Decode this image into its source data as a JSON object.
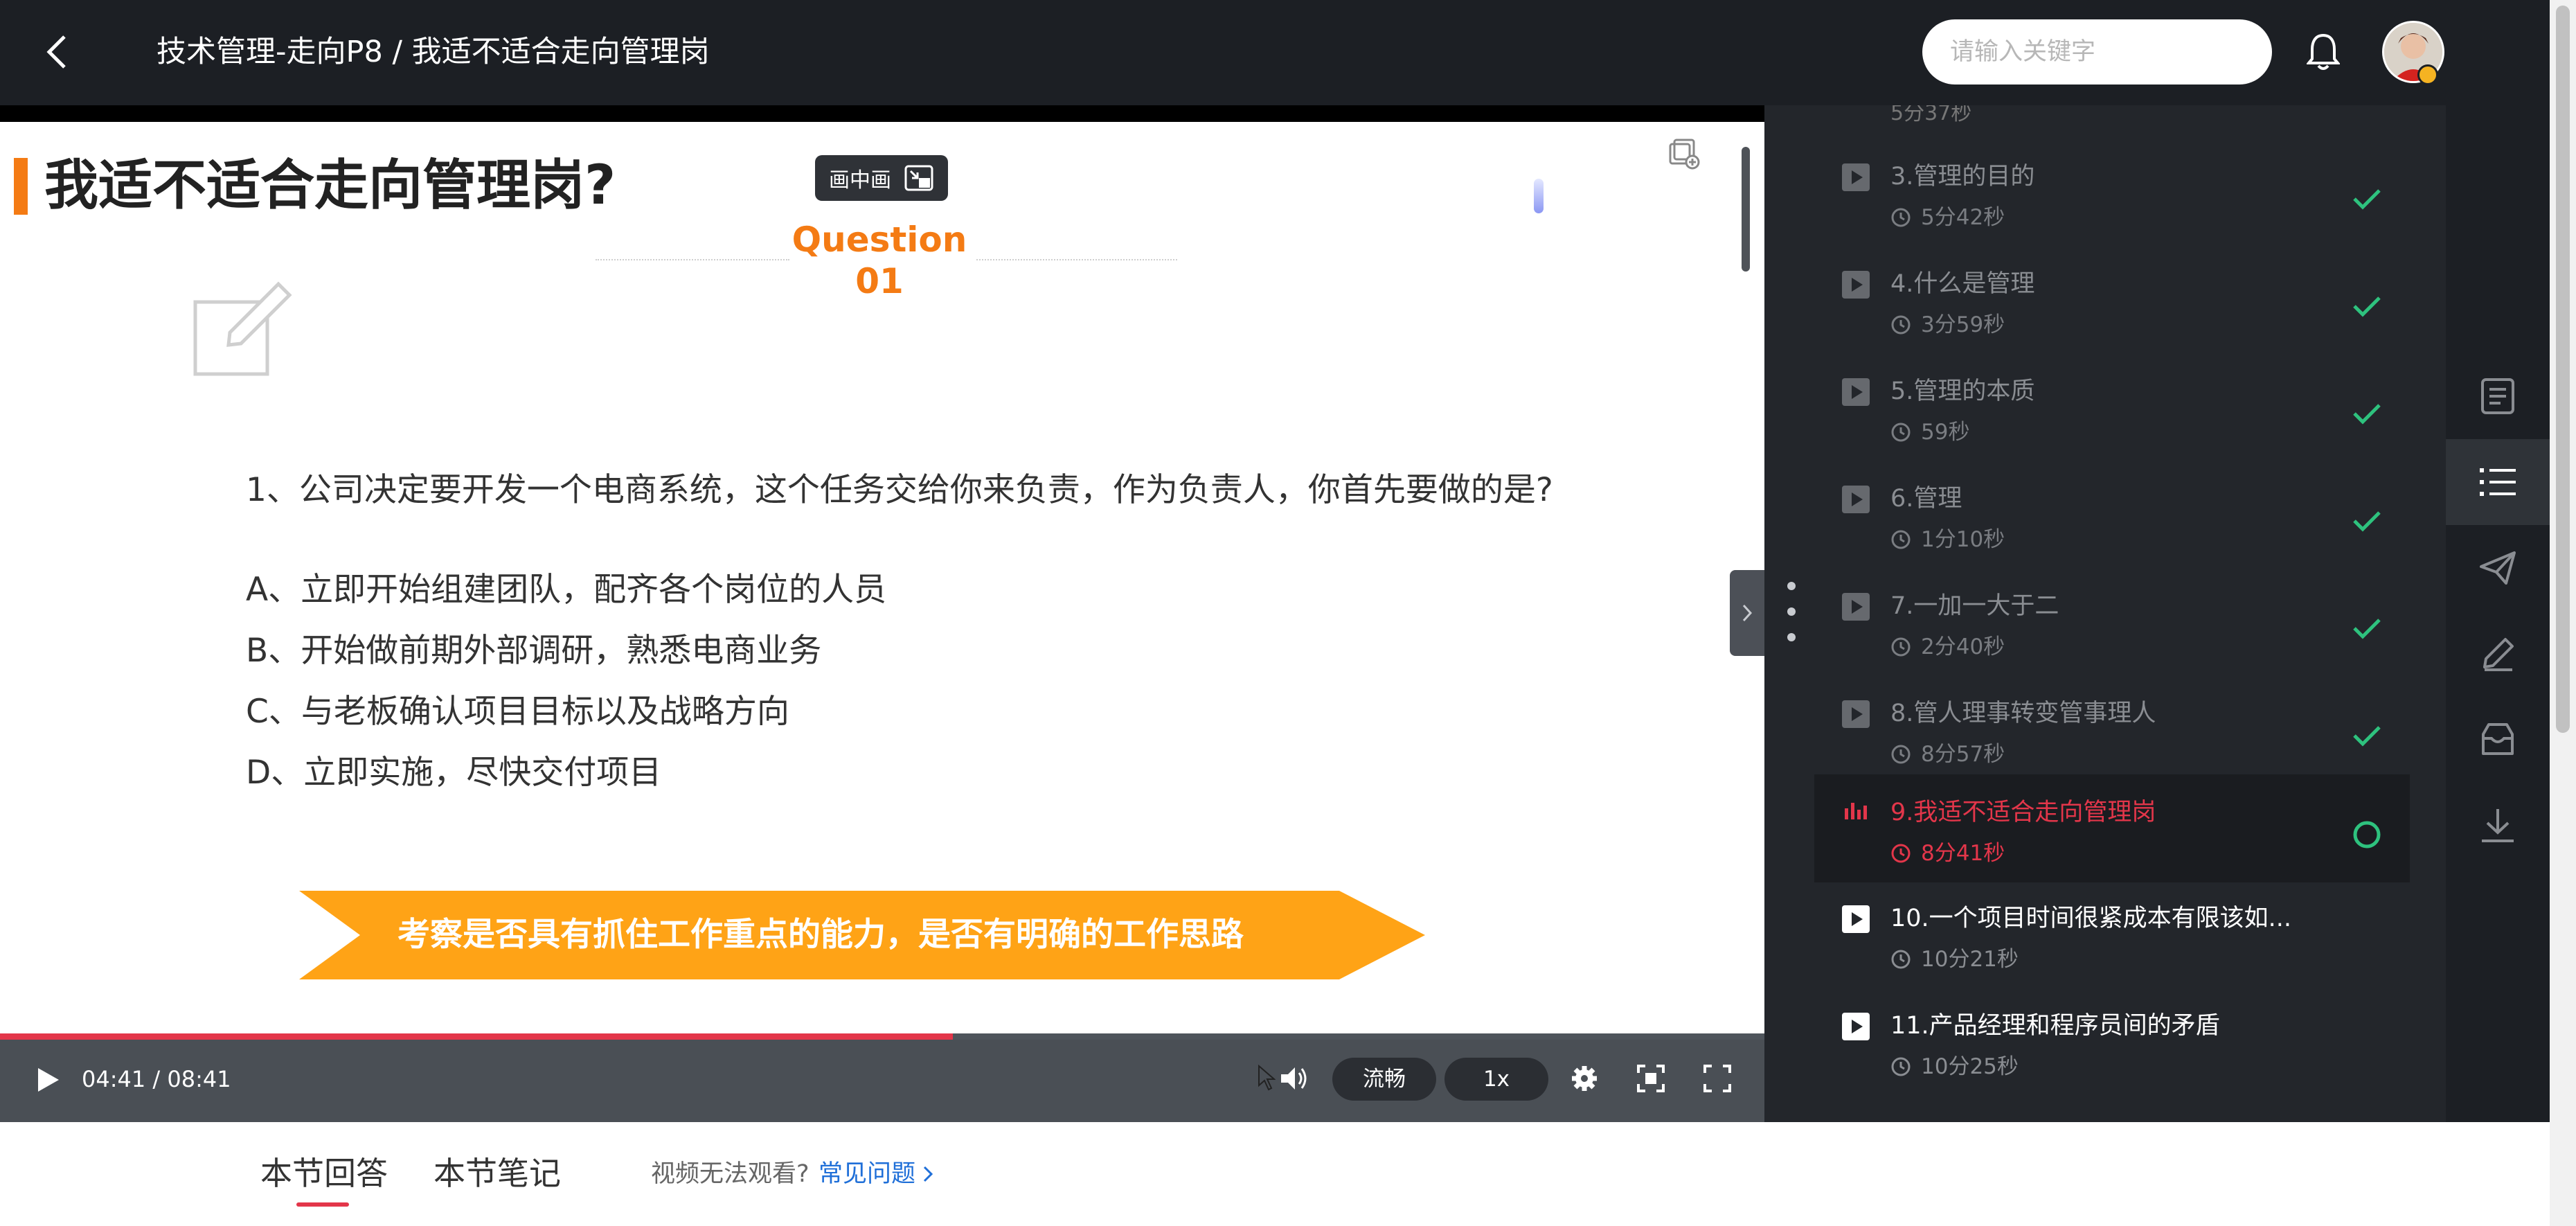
{
  "header": {
    "title": "技术管理-走向P8 / 我适不适合走向管理岗",
    "search_placeholder": "请输入关键字"
  },
  "video": {
    "pip_label": "画中画",
    "slide": {
      "heading": "我适不适合走向管理岗?",
      "question_label": "Question",
      "question_number": "01",
      "question": "1、公司决定要开发一个电商系统，这个任务交给你来负责，作为负责人，你首先要做的是?",
      "options": [
        "A、立即开始组建团队，配齐各个岗位的人员",
        "B、开始做前期外部调研，熟悉电商业务",
        "C、与老板确认项目目标以及战略方向",
        "D、立即实施，尽快交付项目"
      ],
      "banner": "考察是否具有抓住工作重点的能力，是否有明确的工作思路"
    },
    "progress": 0.54,
    "time": "04:41 / 08:41",
    "quality": "流畅",
    "speed": "1x"
  },
  "chapters": {
    "top_partial": "5分37秒",
    "items": [
      {
        "title": "3.管理的目的",
        "duration": "5分42秒",
        "status": "done"
      },
      {
        "title": "4.什么是管理",
        "duration": "3分59秒",
        "status": "done"
      },
      {
        "title": "5.管理的本质",
        "duration": "59秒",
        "status": "done"
      },
      {
        "title": "6.管理",
        "duration": "1分10秒",
        "status": "done"
      },
      {
        "title": "7.一加一大于二",
        "duration": "2分40秒",
        "status": "done"
      },
      {
        "title": "8.管人理事转变管事理人",
        "duration": "8分57秒",
        "status": "done"
      },
      {
        "title": "9.我适不适合走向管理岗",
        "duration": "8分41秒",
        "status": "playing"
      },
      {
        "title": "10.一个项目时间很紧成本有限该如...",
        "duration": "10分21秒",
        "status": "new"
      },
      {
        "title": "11.产品经理和程序员间的矛盾",
        "duration": "10分25秒",
        "status": "new"
      }
    ]
  },
  "bottom": {
    "tabs": [
      "本节回答",
      "本节笔记"
    ],
    "hint": "视频无法观看?",
    "faq": "常见问题"
  },
  "colors": {
    "accent_red": "#e3364a",
    "check_green": "#2ec27e",
    "slide_orange": "#f47b14",
    "banner_orange": "#ffa316"
  }
}
